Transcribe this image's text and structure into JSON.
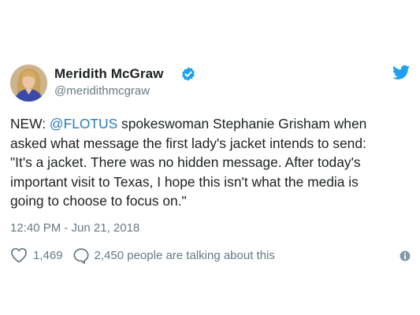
{
  "tweet": {
    "author": {
      "display_name": "Meridith McGraw",
      "handle": "@meridithmcgraw",
      "verified": true
    },
    "body": {
      "line1_prefix": "NEW: ",
      "line1_mention": "@FLOTUS",
      "line1_suffix": " spokeswoman Stephanie Grisham when",
      "line2": "asked what message the first lady's jacket intends to send:",
      "line3": "\"It's a jacket. There was no hidden message. After today's",
      "line4": "important visit to Texas, I hope this isn't what the media is",
      "line5": "going to choose to focus on.\""
    },
    "timestamp": "12:40 PM - Jun 21, 2018",
    "likes": "1,469",
    "talking": "2,450 people are talking about this"
  },
  "icons": {
    "bird": "twitter-bird-icon",
    "verified": "verified-badge-icon",
    "like": "heart-icon",
    "reply": "speech-bubble-icon",
    "info": "info-icon"
  },
  "colors": {
    "brand_blue": "#1da1f2",
    "link_blue": "#2b7bb9",
    "text": "#1c2022",
    "muted": "#697882"
  }
}
